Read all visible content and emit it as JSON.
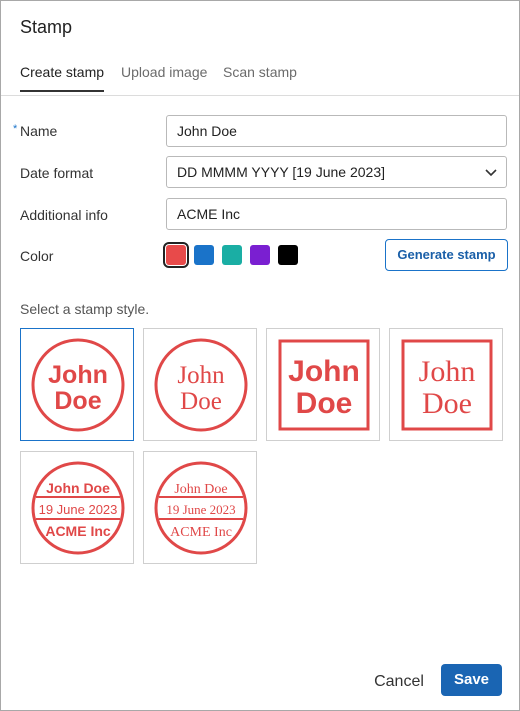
{
  "dialog": {
    "title": "Stamp"
  },
  "tabs": [
    {
      "label": "Create stamp",
      "active": true
    },
    {
      "label": "Upload image",
      "active": false
    },
    {
      "label": "Scan stamp",
      "active": false
    }
  ],
  "form": {
    "name": {
      "label": "Name",
      "required_mark": "*",
      "value": "John Doe"
    },
    "date_format": {
      "label": "Date format",
      "value": "DD MMMM YYYY [19 June 2023]"
    },
    "additional_info": {
      "label": "Additional info",
      "value": "ACME Inc"
    },
    "color": {
      "label": "Color",
      "selected_index": 0,
      "swatches": [
        "#e84a4a",
        "#1a73c9",
        "#1aaea4",
        "#7a1fd1",
        "#000000"
      ]
    }
  },
  "generate_button": {
    "label": "Generate stamp"
  },
  "styles_hint": "Select a stamp style.",
  "stamp_text": {
    "first": "John",
    "last": "Doe",
    "name": "John Doe",
    "date": "19 June 2023",
    "info": "ACME Inc"
  },
  "stamp_color": "#e04848",
  "selected_style_index": 0,
  "footer": {
    "cancel_label": "Cancel",
    "save_label": "Save"
  }
}
